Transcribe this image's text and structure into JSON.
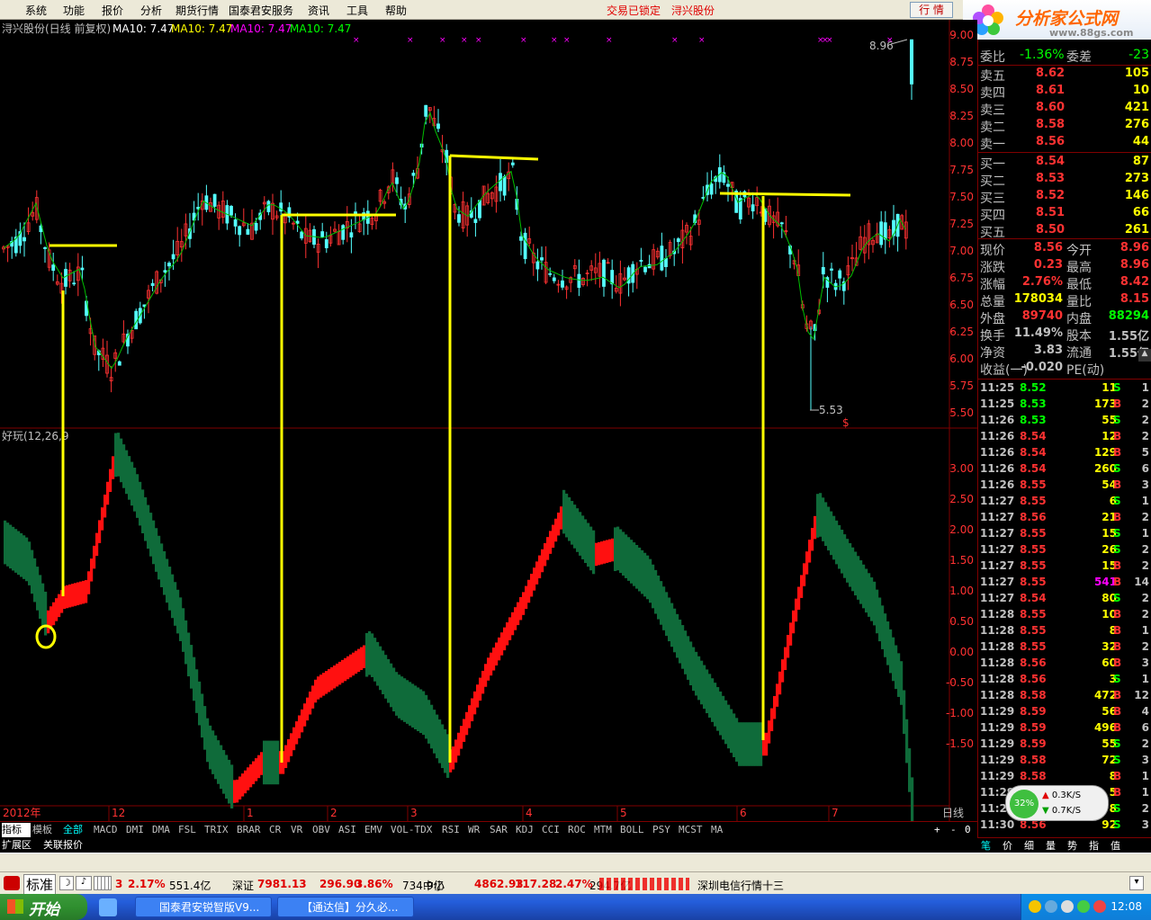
{
  "menu": {
    "items": [
      "系统",
      "功能",
      "报价",
      "分析",
      "期货行情",
      "国泰君安服务",
      "资讯",
      "工具",
      "帮助"
    ],
    "lock_status": "交易已锁定",
    "stock_name": "浔兴股份",
    "quote_button": "行 情"
  },
  "logo": {
    "text": "分析家公式网",
    "url": "www.88gs.com"
  },
  "chart_header": {
    "stock": "浔兴股份(日线 前复权)",
    "ma_labels": [
      "MA10: 7.47",
      "MA10: 7.47",
      "MA10: 7.47",
      "MA10: 7.47"
    ],
    "ma_colors": [
      "#ffffff",
      "#ffff00",
      "#ff00ff",
      "#00ff00"
    ],
    "high_label": "8.96",
    "low_label": "5.53"
  },
  "price_axis": [
    "9.00",
    "8.75",
    "8.50",
    "8.25",
    "8.00",
    "7.75",
    "7.50",
    "7.25",
    "7.00",
    "6.75",
    "6.50",
    "6.25",
    "6.00",
    "5.75",
    "5.50"
  ],
  "indicator": {
    "label": "好玩(12,26,9",
    "axis": [
      "3.00",
      "2.50",
      "2.00",
      "1.50",
      "1.00",
      "0.50",
      "0.00",
      "-0.50",
      "-1.00",
      "-1.50"
    ]
  },
  "date_axis": {
    "year": "2012年",
    "months": [
      "12",
      "1",
      "2",
      "3",
      "4",
      "5",
      "6",
      "7"
    ],
    "period": "日线"
  },
  "panel": {
    "top_row": {
      "label": "委比",
      "value": "-1.36%",
      "label2": "委差",
      "value2": "-23"
    },
    "asks": [
      {
        "label": "卖五",
        "price": "8.62",
        "vol": "105"
      },
      {
        "label": "卖四",
        "price": "8.61",
        "vol": "10"
      },
      {
        "label": "卖三",
        "price": "8.60",
        "vol": "421"
      },
      {
        "label": "卖二",
        "price": "8.58",
        "vol": "276"
      },
      {
        "label": "卖一",
        "price": "8.56",
        "vol": "44"
      }
    ],
    "bids": [
      {
        "label": "买一",
        "price": "8.54",
        "vol": "87"
      },
      {
        "label": "买二",
        "price": "8.53",
        "vol": "273"
      },
      {
        "label": "买三",
        "price": "8.52",
        "vol": "146"
      },
      {
        "label": "买四",
        "price": "8.51",
        "vol": "66"
      },
      {
        "label": "买五",
        "price": "8.50",
        "vol": "261"
      }
    ],
    "stats": [
      {
        "l1": "现价",
        "v1": "8.56",
        "l2": "今开",
        "v2": "8.96",
        "c1": "#ff3232",
        "c2": "#ff3232"
      },
      {
        "l1": "涨跌",
        "v1": "0.23",
        "l2": "最高",
        "v2": "8.96",
        "c1": "#ff3232",
        "c2": "#ff3232"
      },
      {
        "l1": "涨幅",
        "v1": "2.76%",
        "l2": "最低",
        "v2": "8.42",
        "c1": "#ff3232",
        "c2": "#ff3232"
      },
      {
        "l1": "总量",
        "v1": "178034",
        "l2": "量比",
        "v2": "8.15",
        "c1": "#ffff00",
        "c2": "#ff3232"
      },
      {
        "l1": "外盘",
        "v1": "89740",
        "l2": "内盘",
        "v2": "88294",
        "c1": "#ff3232",
        "c2": "#00ff00"
      },
      {
        "l1": "换手",
        "v1": "11.49%",
        "l2": "股本",
        "v2": "1.55亿",
        "c1": "#c0c0c0",
        "c2": "#c0c0c0"
      },
      {
        "l1": "净资",
        "v1": "3.83",
        "l2": "流通",
        "v2": "1.55亿",
        "c1": "#c0c0c0",
        "c2": "#c0c0c0"
      },
      {
        "l1": "收益(一)",
        "v1": "-0.020",
        "l2": "PE(动)",
        "v2": "",
        "c1": "#c0c0c0",
        "c2": "#c0c0c0"
      }
    ],
    "ticks": [
      [
        "11:25",
        "8.52",
        "11",
        "S",
        "1"
      ],
      [
        "11:25",
        "8.53",
        "173",
        "B",
        "2"
      ],
      [
        "11:26",
        "8.53",
        "55",
        "S",
        "2"
      ],
      [
        "11:26",
        "8.54",
        "12",
        "B",
        "2"
      ],
      [
        "11:26",
        "8.54",
        "129",
        "B",
        "5"
      ],
      [
        "11:26",
        "8.54",
        "260",
        "S",
        "6"
      ],
      [
        "11:26",
        "8.55",
        "54",
        "B",
        "3"
      ],
      [
        "11:27",
        "8.55",
        "6",
        "S",
        "1"
      ],
      [
        "11:27",
        "8.56",
        "21",
        "B",
        "2"
      ],
      [
        "11:27",
        "8.55",
        "15",
        "S",
        "1"
      ],
      [
        "11:27",
        "8.55",
        "26",
        "S",
        "2"
      ],
      [
        "11:27",
        "8.55",
        "15",
        "B",
        "2"
      ],
      [
        "11:27",
        "8.55",
        "541",
        "B",
        "14"
      ],
      [
        "11:27",
        "8.54",
        "80",
        "S",
        "2"
      ],
      [
        "11:28",
        "8.55",
        "10",
        "B",
        "2"
      ],
      [
        "11:28",
        "8.55",
        "8",
        "B",
        "1"
      ],
      [
        "11:28",
        "8.55",
        "32",
        "B",
        "2"
      ],
      [
        "11:28",
        "8.56",
        "60",
        "B",
        "3"
      ],
      [
        "11:28",
        "8.56",
        "3",
        "S",
        "1"
      ],
      [
        "11:28",
        "8.58",
        "472",
        "B",
        "12"
      ],
      [
        "11:29",
        "8.59",
        "56",
        "B",
        "4"
      ],
      [
        "11:29",
        "8.59",
        "496",
        "B",
        "6"
      ],
      [
        "11:29",
        "8.59",
        "55",
        "S",
        "2"
      ],
      [
        "11:29",
        "8.58",
        "72",
        "S",
        "3"
      ],
      [
        "11:29",
        "8.58",
        "8",
        "B",
        "1"
      ],
      [
        "11:29",
        "8.59",
        "5",
        "B",
        "1"
      ],
      [
        "11:29",
        "8.57",
        "8",
        "S",
        "2"
      ],
      [
        "11:30",
        "8.56",
        "92",
        "S",
        "3"
      ]
    ]
  },
  "net_widget": {
    "percent": "32%",
    "up": "0.3K/S",
    "down": "0.7K/S"
  },
  "indicator_tabs": [
    "指标",
    "模板",
    "全部",
    "MACD",
    "DMI",
    "DMA",
    "FSL",
    "TRIX",
    "BRAR",
    "CR",
    "VR",
    "OBV",
    "ASI",
    "EMV",
    "VOL-TDX",
    "RSI",
    "WR",
    "SAR",
    "KDJ",
    "CCI",
    "ROC",
    "MTM",
    "BOLL",
    "PSY",
    "MCST",
    "MA"
  ],
  "ext_tabs": [
    "扩展区",
    "关联报价"
  ],
  "panel_tabs": [
    "笔",
    "价",
    "细",
    "量",
    "势",
    "指",
    "值"
  ],
  "status": {
    "btn": "标准",
    "items": [
      {
        "t": "3",
        "c": "#e00000"
      },
      {
        "t": "2.17%",
        "c": "#e00000"
      },
      {
        "t": "551.4亿",
        "c": "#000"
      },
      {
        "t": "深证",
        "c": "#000"
      },
      {
        "t": "7981.13",
        "c": "#e00000"
      },
      {
        "t": "296.90",
        "c": "#e00000"
      },
      {
        "t": "3.86%",
        "c": "#e00000"
      },
      {
        "t": "734.9亿",
        "c": "#000"
      },
      {
        "t": "中小",
        "c": "#000"
      },
      {
        "t": "4862.93",
        "c": "#e00000"
      },
      {
        "t": "117.28",
        "c": "#e00000"
      },
      {
        "t": "2.47%",
        "c": "#e00000"
      },
      {
        "t": "294.7亿",
        "c": "#000"
      }
    ],
    "ticker": "深圳电信行情十三"
  },
  "taskbar": {
    "start": "开始",
    "tasks": [
      "国泰君安锐智版V9...",
      "【通达信】分久必..."
    ],
    "clock": "12:08"
  }
}
